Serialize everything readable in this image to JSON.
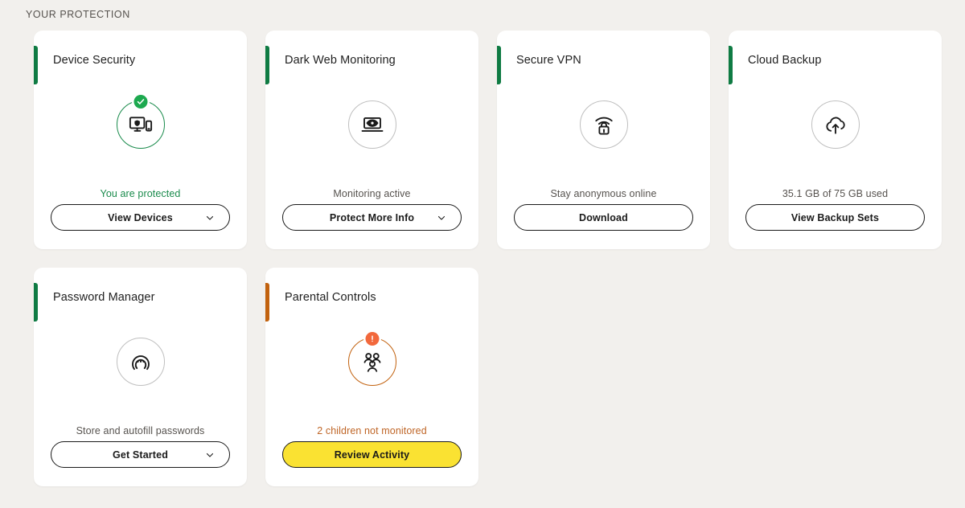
{
  "section": {
    "title": "YOUR PROTECTION"
  },
  "colors": {
    "page_background": "#F2F0ED",
    "card_background": "#FFFFFF",
    "accent_green": "#0F7B43",
    "accent_orange": "#C2620F",
    "status_green": "#1A8B4C",
    "status_orange": "#BF6526",
    "badge_green": "#1DA94F",
    "badge_alert_orange": "#F2683C",
    "button_border": "#1A1A1A",
    "button_yellow": "#FAE232"
  },
  "cards": [
    {
      "title": "Device Security",
      "accent": "green",
      "icon": "device-shield-icon",
      "ring": "green",
      "badge": "check-badge-icon",
      "status": "You are protected",
      "status_style": "green",
      "button": {
        "label": "View Devices",
        "style": "outline",
        "chevron": true
      }
    },
    {
      "title": "Dark Web Monitoring",
      "accent": "green",
      "icon": "laptop-eye-icon",
      "ring": "grey",
      "badge": null,
      "status": "Monitoring active",
      "status_style": "grey",
      "button": {
        "label": "Protect More Info",
        "style": "outline",
        "chevron": true
      }
    },
    {
      "title": "Secure VPN",
      "accent": "green",
      "icon": "wifi-lock-icon",
      "ring": "grey",
      "badge": null,
      "status": "Stay anonymous online",
      "status_style": "grey",
      "button": {
        "label": "Download",
        "style": "outline",
        "chevron": false
      }
    },
    {
      "title": "Cloud Backup",
      "accent": "green",
      "icon": "cloud-upload-icon",
      "ring": "grey",
      "badge": null,
      "status": "35.1 GB of 75 GB used",
      "status_style": "grey",
      "button": {
        "label": "View Backup Sets",
        "style": "outline",
        "chevron": false
      }
    },
    {
      "title": "Password Manager",
      "accent": "green",
      "icon": "password-vault-icon",
      "ring": "grey",
      "badge": null,
      "status": "Store and autofill passwords",
      "status_style": "grey",
      "button": {
        "label": "Get Started",
        "style": "outline",
        "chevron": true
      }
    },
    {
      "title": "Parental Controls",
      "accent": "orange",
      "icon": "family-people-icon",
      "ring": "orange",
      "badge": "alert-badge-icon",
      "status": "2 children not monitored",
      "status_style": "orange",
      "button": {
        "label": "Review Activity",
        "style": "yellow",
        "chevron": false
      }
    }
  ]
}
